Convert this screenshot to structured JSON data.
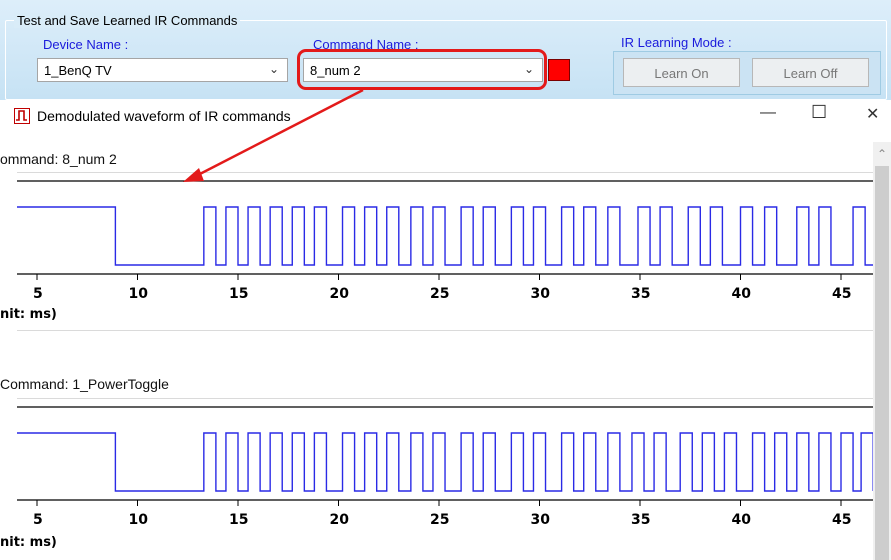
{
  "panel": {
    "group_title": "Test and Save Learned IR Commands",
    "device_label": "Device Name :",
    "device_value": "1_BenQ TV",
    "command_label": "Command Name :",
    "command_value": "8_num 2",
    "ir_mode_label": "IR Learning Mode :",
    "learn_on": "Learn On",
    "learn_off": "Learn Off"
  },
  "window": {
    "title": "Demodulated waveform of IR commands",
    "minimize": "—",
    "maximize": "☐",
    "close": "✕"
  },
  "plots": [
    {
      "command_text": "ommand:  8_num 2",
      "unit_text": "nit: ms)",
      "tick_labels": [
        "5",
        "10",
        "15",
        "20",
        "25",
        "30",
        "35",
        "40",
        "45"
      ]
    },
    {
      "command_text": "Command:  1_PowerToggle",
      "unit_text": "nit: ms)",
      "tick_labels": [
        "5",
        "10",
        "15",
        "20",
        "25",
        "30",
        "35",
        "40",
        "45"
      ]
    }
  ],
  "colors": {
    "waveform": "#2a2ae6",
    "highlight": "#e31a1a",
    "label_blue": "#1a1adc"
  },
  "icons": {
    "dropdown": "chevron-down-icon",
    "scroll": "chevron-up-icon",
    "app": "waveform-icon"
  }
}
